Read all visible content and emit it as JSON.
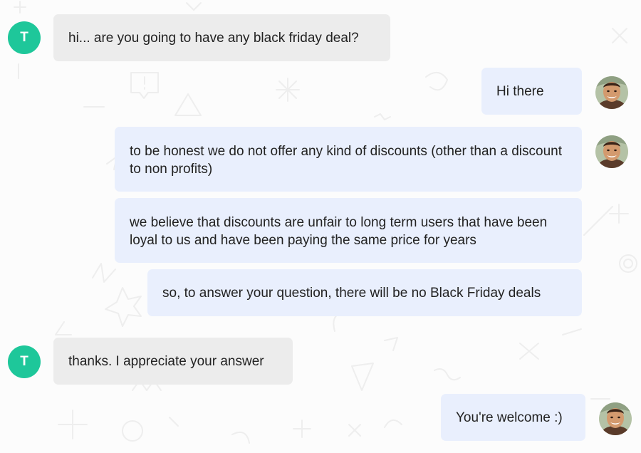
{
  "colors": {
    "visitor_avatar": "#1ec79a",
    "visitor_bubble": "#ececec",
    "agent_bubble": "#e9effd",
    "text": "#222222"
  },
  "visitor": {
    "initial": "T"
  },
  "agent": {
    "avatar_icon": "agent-photo"
  },
  "messages": [
    {
      "sender": "visitor",
      "text": "hi... are you going to have any black friday deal?"
    },
    {
      "sender": "agent",
      "text": "Hi there"
    },
    {
      "sender": "agent",
      "text": "to be honest we do not offer any kind of discounts (other than a discount to non profits)"
    },
    {
      "sender": "agent",
      "text": "we believe that discounts are unfair to long term users that have been loyal to us and have been paying the same price for years"
    },
    {
      "sender": "agent",
      "text": "so, to answer your question, there will be no Black Friday deals"
    },
    {
      "sender": "visitor",
      "text": "thanks. I appreciate your answer"
    },
    {
      "sender": "agent",
      "text": "You're welcome :)"
    }
  ]
}
